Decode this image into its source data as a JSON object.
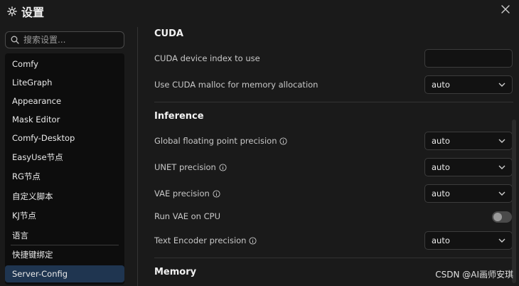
{
  "header": {
    "title": "设置",
    "gear_icon": "gear-icon",
    "close_icon": "close-icon"
  },
  "search": {
    "placeholder": "搜索设置..."
  },
  "sidebar": {
    "items": [
      {
        "label": "Comfy"
      },
      {
        "label": "LiteGraph"
      },
      {
        "label": "Appearance"
      },
      {
        "label": "Mask Editor"
      },
      {
        "label": "Comfy-Desktop"
      },
      {
        "label": "EasyUse节点"
      },
      {
        "label": "RG节点"
      },
      {
        "label": "自定义脚本"
      },
      {
        "label": "KJ节点"
      },
      {
        "label": "语言"
      },
      {
        "label": "快捷键绑定"
      },
      {
        "label": "Server-Config",
        "active": true
      }
    ]
  },
  "main": {
    "cuda": {
      "title": "CUDA",
      "device_label": "CUDA device index to use",
      "device_value": "",
      "malloc_label": "Use CUDA malloc for memory allocation",
      "malloc_value": "auto"
    },
    "inference": {
      "title": "Inference",
      "global_label": "Global floating point precision",
      "global_value": "auto",
      "unet_label": "UNET precision",
      "unet_value": "auto",
      "vae_label": "VAE precision",
      "vae_value": "auto",
      "vae_cpu_label": "Run VAE on CPU",
      "vae_cpu_on": false,
      "text_encoder_label": "Text Encoder precision",
      "text_encoder_value": "auto"
    },
    "memory": {
      "title": "Memory"
    }
  },
  "watermark": "CSDN @AI画师安琪",
  "colors": {
    "active_bg": "#1f3550",
    "background": "#1a1a1a"
  }
}
